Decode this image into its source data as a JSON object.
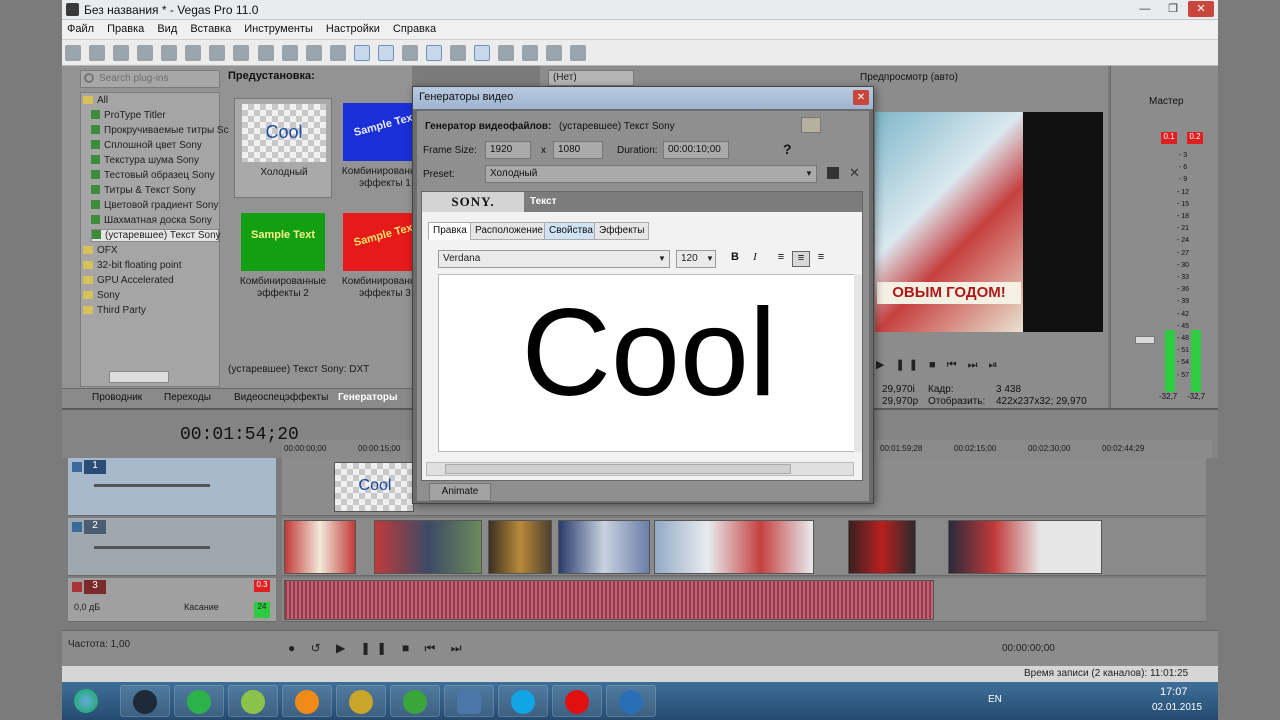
{
  "window": {
    "title": "Без названия * - Vegas Pro 11.0",
    "minimize": "—",
    "maximize": "❐",
    "close": "✕"
  },
  "menu": [
    "Файл",
    "Правка",
    "Вид",
    "Вставка",
    "Инструменты",
    "Настройки",
    "Справка"
  ],
  "plugins": {
    "search_placeholder": "Search plug-ins",
    "tree": [
      {
        "label": "All",
        "type": "folder"
      },
      {
        "label": "ProType Titler",
        "type": "gen"
      },
      {
        "label": "Прокручиваемые титры Sc",
        "type": "gen"
      },
      {
        "label": "Сплошной цвет Sony",
        "type": "gen"
      },
      {
        "label": "Текстура шума Sony",
        "type": "gen"
      },
      {
        "label": "Тестовый образец Sony",
        "type": "gen"
      },
      {
        "label": "Титры & Текст Sony",
        "type": "gen"
      },
      {
        "label": "Цветовой градиент Sony",
        "type": "gen"
      },
      {
        "label": "Шахматная доска Sony",
        "type": "gen"
      },
      {
        "label": "(устаревшее) Текст Sony",
        "type": "gen"
      },
      {
        "label": "OFX",
        "type": "folder"
      },
      {
        "label": "32-bit floating point",
        "type": "folder"
      },
      {
        "label": "GPU Accelerated",
        "type": "folder"
      },
      {
        "label": "Sony",
        "type": "folder"
      },
      {
        "label": "Third Party",
        "type": "folder"
      }
    ]
  },
  "presets": {
    "heading": "Предустановка:",
    "items": [
      {
        "thumb_text": "Cool",
        "name": "Холодный"
      },
      {
        "thumb_text": "Sample Text",
        "name": "Комбинированные эффекты 1"
      },
      {
        "thumb_text": "Sample Text",
        "name": "Комбинированные эффекты 2"
      },
      {
        "thumb_text": "Sample Text",
        "name": "Комбинированные эффекты 3"
      }
    ],
    "status": "(устаревшее) Текст Sony: DXT"
  },
  "left_tabs": [
    "Проводник",
    "Переходы",
    "Видеоспецэффекты",
    "Генераторы"
  ],
  "preview": {
    "mode_select": "(Нет)",
    "quality_label": "Предпросмотр (авто)",
    "video_caption": "ОВЫМ ГОДОМ!",
    "frame_rate": "29,970i",
    "frame_rate2": "29,970p",
    "frame_label": "Кадр:",
    "frame_value": "3 438",
    "display_label": "Отобразить:",
    "display_value": "422x237x32; 29,970"
  },
  "master": {
    "label": "Мастер",
    "peak_left": "0.1",
    "peak_right": "0.2",
    "scale": [
      "3",
      "6",
      "9",
      "12",
      "15",
      "18",
      "21",
      "24",
      "27",
      "30",
      "33",
      "36",
      "39",
      "42",
      "45",
      "48",
      "51",
      "54",
      "57"
    ],
    "level_left": "-32,7",
    "level_right": "-32,7"
  },
  "timeline": {
    "timecode": "00:01:54;20",
    "ruler": [
      "00:00:00;00",
      "00:00:15;00",
      "00:01:59;28",
      "00:02:15;00",
      "00:02:30;00",
      "00:02:44;29"
    ],
    "tracks": [
      {
        "number": "1"
      },
      {
        "number": "2"
      },
      {
        "number": "3",
        "volume": "0,0 дБ",
        "mode": "Касание",
        "peak": "0.3",
        "meter": "24"
      }
    ],
    "cool_clip_text": "Cool",
    "rate_label": "Частота: 1,00",
    "cursor_time": "00:00:00;00",
    "record_status": "Время записи (2 каналов): 11:01:25"
  },
  "dialog": {
    "title": "Генераторы видео",
    "close": "✕",
    "generator_label": "Генератор видеофайлов:",
    "generator_value": "(устаревшее) Текст Sony",
    "frame_size_label": "Frame Size:",
    "frame_w": "1920",
    "frame_x": "x",
    "frame_h": "1080",
    "duration_label": "Duration:",
    "duration_value": "00:00:10;00",
    "preset_label": "Preset:",
    "preset_value": "Холодный",
    "brand": "SONY.",
    "panel_title": "Текст",
    "tabs": [
      "Правка",
      "Расположение",
      "Свойства",
      "Эффекты"
    ],
    "font": "Verdana",
    "size": "120",
    "bold": "B",
    "italic": "I",
    "text": "Cool",
    "animate": "Animate"
  },
  "taskbar": {
    "lang": "EN",
    "time": "17:07",
    "date": "02.01.2015"
  },
  "colors": {
    "accent_blue": "#1a4aa0",
    "peak_red": "#e02020",
    "meter_green": "#2ecc40",
    "audio_wave": "#9c3a4a"
  }
}
